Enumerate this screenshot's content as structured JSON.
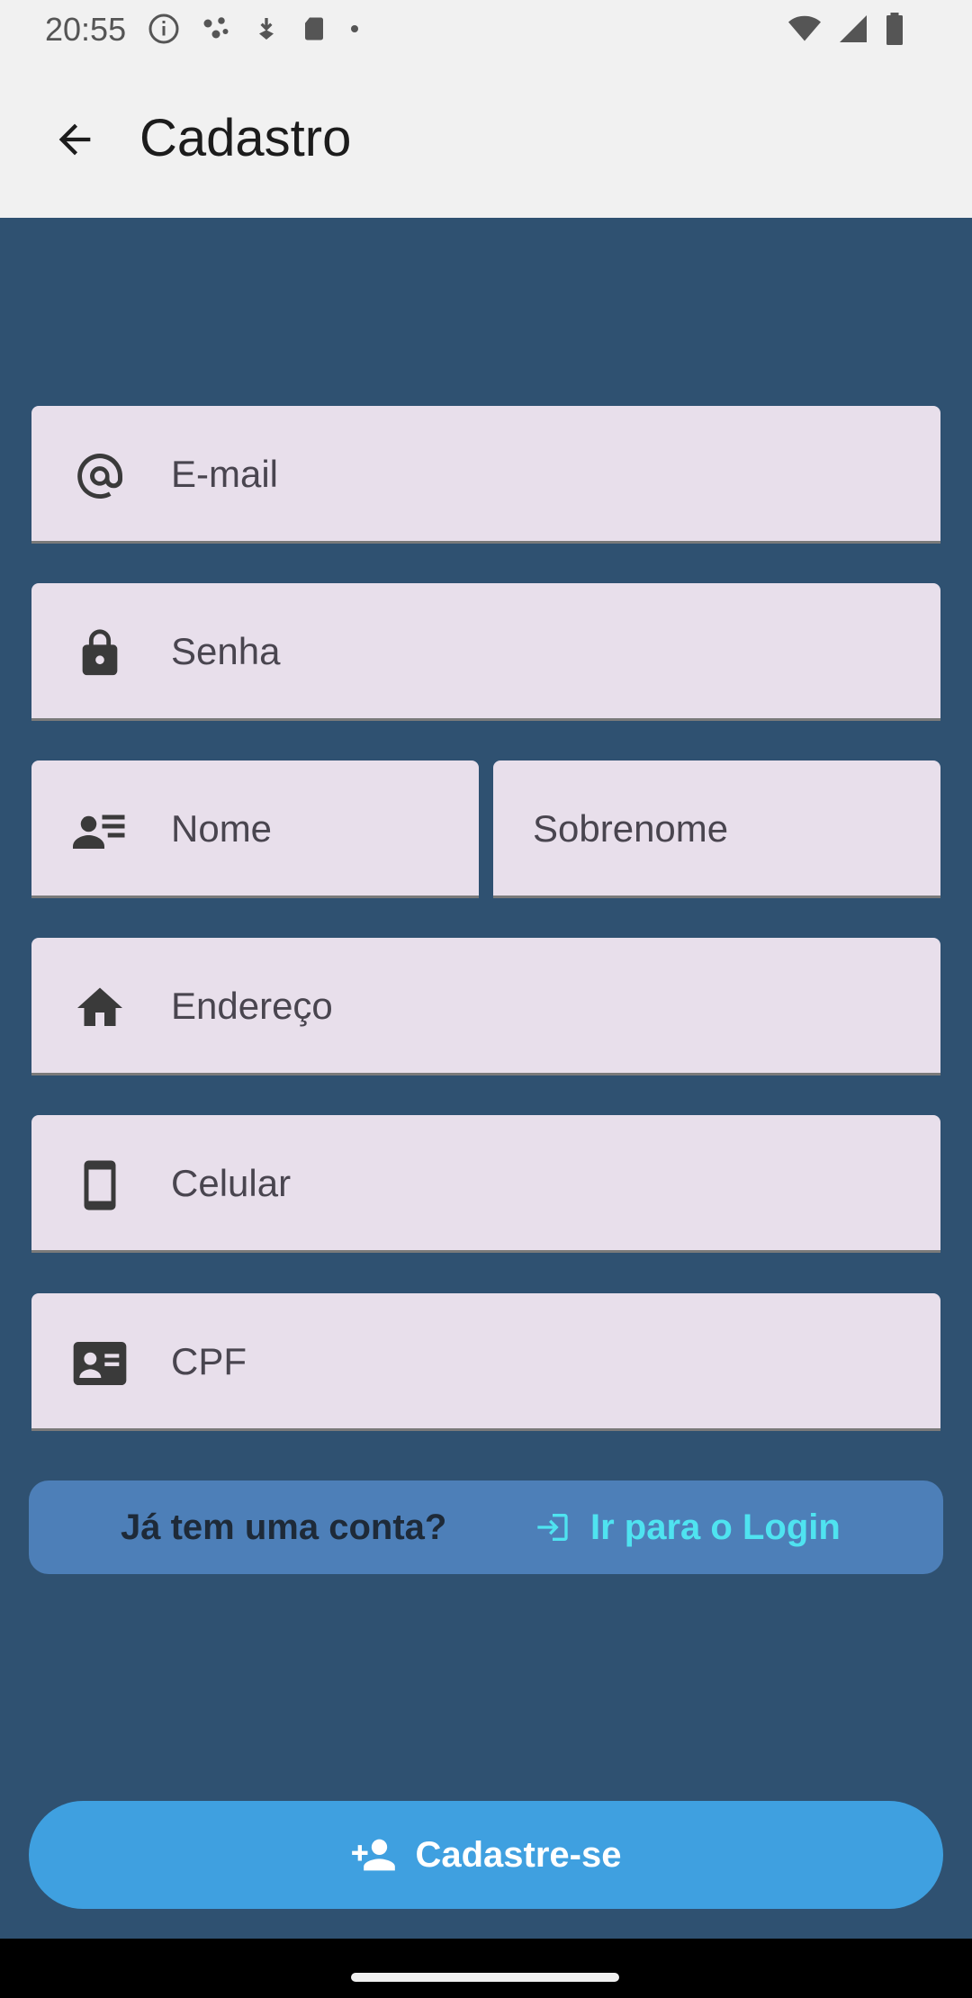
{
  "status_bar": {
    "time": "20:55"
  },
  "app_bar": {
    "title": "Cadastro",
    "back_icon": "arrow-back-icon"
  },
  "form": {
    "fields": [
      {
        "icon": "at-sign-icon",
        "placeholder": "E-mail"
      },
      {
        "icon": "lock-icon",
        "placeholder": "Senha"
      },
      {
        "icon": "badge-person-icon",
        "placeholder": "Nome"
      },
      {
        "icon": "",
        "placeholder": "Sobrenome"
      },
      {
        "icon": "home-icon",
        "placeholder": "Endereço"
      },
      {
        "icon": "smartphone-icon",
        "placeholder": "Celular"
      },
      {
        "icon": "id-card-icon",
        "placeholder": "CPF"
      }
    ],
    "field_background": "#e8dfeb"
  },
  "login_prompt": {
    "question": "Já tem uma conta?",
    "link_label": "Ir para o Login",
    "link_icon": "login-icon",
    "link_color": "#4fe3f0"
  },
  "submit": {
    "label": "Cadastre-se",
    "icon": "person-add-icon",
    "color": "#3fa0e0"
  },
  "colors": {
    "background": "#2f5171",
    "app_bar": "#f1f1f1"
  }
}
